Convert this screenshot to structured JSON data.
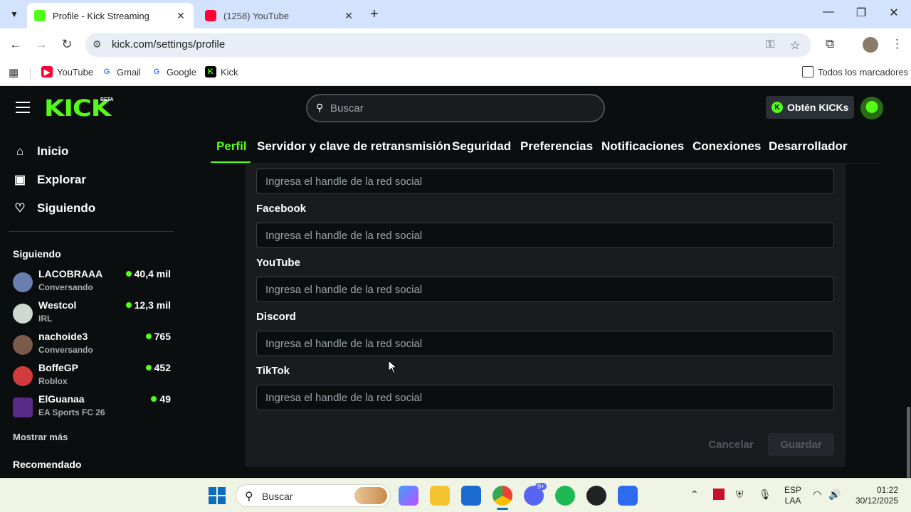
{
  "browser": {
    "tabs": [
      {
        "title": "Profile - Kick Streaming",
        "active": true
      },
      {
        "title": "(1258) YouTube",
        "active": false
      }
    ],
    "url": "kick.com/settings/profile",
    "bookmarks": [
      {
        "label": "YouTube",
        "icon": "youtube-icon"
      },
      {
        "label": "Gmail",
        "icon": "google-icon"
      },
      {
        "label": "Google",
        "icon": "google-icon"
      },
      {
        "label": "Kick",
        "icon": "kick-icon"
      }
    ],
    "all_bookmarks": "Todos los marcadores"
  },
  "header": {
    "logo": "KICK",
    "beta": "BETA",
    "search_placeholder": "Buscar",
    "kicks_button": "Obtén KICKs"
  },
  "sidebar": {
    "nav": [
      {
        "label": "Inicio",
        "icon": "home-icon"
      },
      {
        "label": "Explorar",
        "icon": "compass-icon"
      },
      {
        "label": "Siguiendo",
        "icon": "heart-icon"
      }
    ],
    "following_heading": "Siguiendo",
    "following": [
      {
        "name": "LACOBRAAA",
        "category": "Conversando",
        "viewers": "40,4 mil",
        "avatar_color": "#6a7fb0"
      },
      {
        "name": "Westcol",
        "category": "IRL",
        "viewers": "12,3 mil",
        "avatar_color": "#cfd8d0"
      },
      {
        "name": "nachoide3",
        "category": "Conversando",
        "viewers": "765",
        "avatar_color": "#7a5a4a"
      },
      {
        "name": "BoffeGP",
        "category": "Roblox",
        "viewers": "452",
        "avatar_color": "#d23b3b"
      },
      {
        "name": "ElGuanaa",
        "category": "EA Sports FC 26",
        "viewers": "49",
        "avatar_color": "#5a2a8a"
      }
    ],
    "show_more": "Mostrar más",
    "recommended_heading": "Recomendado"
  },
  "settings_tabs": [
    "Perfil",
    "Servidor y clave de retransmisión",
    "Seguridad",
    "Preferencias",
    "Notificaciones",
    "Conexiones",
    "Desarrollador"
  ],
  "social_fields": {
    "placeholder": "Ingresa el handle de la red social",
    "labels": [
      "Facebook",
      "YouTube",
      "Discord",
      "TikTok"
    ]
  },
  "actions": {
    "cancel": "Cancelar",
    "save": "Guardar"
  },
  "taskbar": {
    "search_placeholder": "Buscar",
    "language": "ESP",
    "layout": "LAA",
    "time": "01:22",
    "date": "30/12/2025",
    "discord_badge": "9+"
  },
  "colors": {
    "accent": "#53fc18",
    "background": "#0b0e0f",
    "panel": "#191b1f"
  }
}
